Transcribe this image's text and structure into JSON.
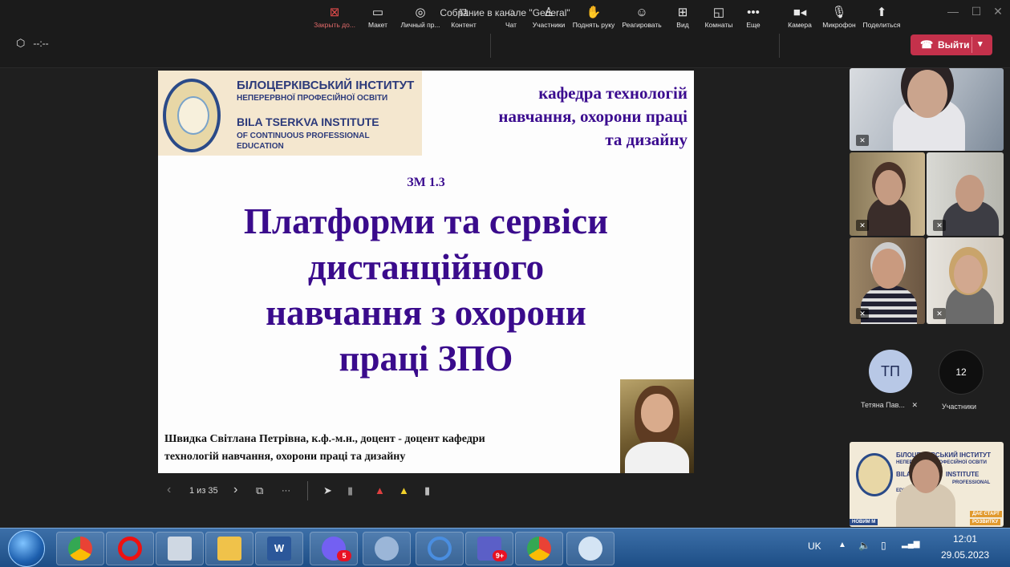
{
  "window": {
    "title": "Собрание в канале \"General\"",
    "minimize": "—",
    "maximize": "☐",
    "close": "✕"
  },
  "meeting": {
    "timer": "--:--"
  },
  "toolbar": {
    "close_content": "Закрыть до...",
    "layout": "Макет",
    "personal": "Личный пр...",
    "content": "Контент",
    "chat": "Чат",
    "participants": "Участники",
    "raise_hand": "Поднять руку",
    "react": "Реагировать",
    "view": "Вид",
    "rooms": "Комнаты",
    "more": "Еще",
    "camera": "Камера",
    "mic": "Микрофон",
    "share": "Поделиться",
    "leave": "Выйти"
  },
  "slide": {
    "inst_ua_1": "БІЛОЦЕРКІВСЬКИЙ ІНСТИТУТ",
    "inst_ua_2": "НЕПЕРЕРВНОЇ ПРОФЕСІЙНОЇ ОСВІТИ",
    "inst_en_1": "BILA TSERKVA INSTITUTE",
    "inst_en_2": "OF CONTINUOUS PROFESSIONAL",
    "inst_en_3": "EDUCATION",
    "dept_1": "кафедра технологій",
    "dept_2": "навчання, охорони праці",
    "dept_3": "та дизайну",
    "code": "ЗМ 1.3",
    "title_1": "Платформи та сервіси",
    "title_2": "дистанційного",
    "title_3": "навчання з охорони",
    "title_4": "праці ЗПО",
    "author_1": "Швидка Світлана Петрівна, к.ф.-м.н., доцент - доцент кафедри",
    "author_2": "технологій навчання, охорони праці та дизайну"
  },
  "slide_nav": {
    "prev": "‹",
    "page": "1 из 35",
    "next": "›",
    "more": "···"
  },
  "participants": {
    "avatar_initials": "ТП",
    "avatar_name": "Тетяна Пав...",
    "count": "12",
    "count_label": "Участники"
  },
  "self_view": {
    "line_1": "БІЛОЦЕРКІВСЬКИЙ ІНСТИТУТ",
    "line_2": "НЕПЕРЕРВНОЇ ПРОФЕСІЙНОЇ ОСВІТИ",
    "line_3": "BILA",
    "line_4": "INSTITUTE",
    "line_5": "PROFESSIONAL",
    "line_6": "EDUC",
    "ribbon_1": "ДАЄ СТАРТ",
    "ribbon_2": "РОЗВИТКУ",
    "ribbon_3": "НОВИМ М"
  },
  "taskbar": {
    "lang": "UK",
    "time": "12:01",
    "date": "29.05.2023",
    "viber_badge": "5",
    "teams_badge": "9+"
  },
  "colors": {
    "accent_purple": "#3a0b8c",
    "leave_red": "#c4314b",
    "taskbar": "#1d4e86"
  }
}
